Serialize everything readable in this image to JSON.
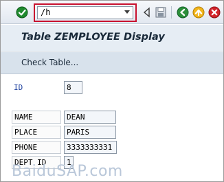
{
  "toolbar": {
    "command_field_value": "/h",
    "icons": [
      "check-icon",
      "dropdown-arrow-icon",
      "back-triangle-icon",
      "save-icon",
      "back-icon",
      "exit-icon",
      "cancel-icon"
    ]
  },
  "header": {
    "title": "Table ZEMPLOYEE Display"
  },
  "app_toolbar": {
    "check_table_label": "Check Table..."
  },
  "form": {
    "id": {
      "label": "ID",
      "value": "8"
    },
    "fields": [
      {
        "label": "NAME",
        "value": "DEAN"
      },
      {
        "label": "PLACE",
        "value": "PARIS"
      },
      {
        "label": "PHONE",
        "value": "3333333331"
      },
      {
        "label": "DEPT ID",
        "value": "1"
      }
    ]
  },
  "watermark": "BaiduSAP.com",
  "colors": {
    "highlight_red": "#c8102e",
    "label_blue": "#1c3f9e",
    "title_band": "#e6edf4",
    "toolbar_band": "#d8e2ec"
  }
}
